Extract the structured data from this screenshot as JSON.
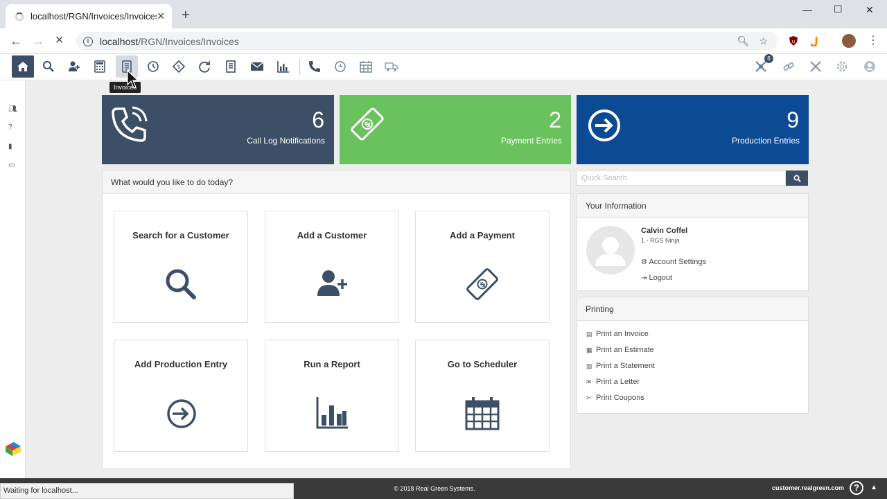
{
  "browser": {
    "tab_title": "localhost/RGN/Invoices/Invoices",
    "url_host": "localhost",
    "url_path": "/RGN/Invoices/Invoices"
  },
  "toolbar": {
    "tooltip": "Invoices",
    "notification_count": "6"
  },
  "tiles": [
    {
      "value": "6",
      "label": "Call Log Notifications",
      "color": "#3d4f66"
    },
    {
      "value": "2",
      "label": "Payment Entries",
      "color": "#6ac25f"
    },
    {
      "value": "9",
      "label": "Production Entries",
      "color": "#0d4a94"
    }
  ],
  "main": {
    "heading": "What would you like to do today?",
    "cards": [
      {
        "label": "Search for a Customer"
      },
      {
        "label": "Add a Customer"
      },
      {
        "label": "Add a Payment"
      },
      {
        "label": "Add Production Entry"
      },
      {
        "label": "Run a Report"
      },
      {
        "label": "Go to Scheduler"
      }
    ]
  },
  "search": {
    "placeholder": "Quick Search"
  },
  "user_info": {
    "heading": "Your Information",
    "name": "Calvin Coffel",
    "role": "1 - RGS Ninja",
    "account_settings": "Account Settings",
    "logout": "Logout"
  },
  "printing": {
    "heading": "Printing",
    "links": [
      "Print an Invoice",
      "Print an Estimate",
      "Print a Statement",
      "Print a Letter",
      "Print Coupons"
    ]
  },
  "footer": {
    "copyright": "© 2018 Real Green Systems.",
    "site": "customer.realgreen.com"
  },
  "status_bar": "Waiting for localhost...",
  "colors": {
    "navy": "#3d4f66",
    "green": "#6ac25f",
    "blue": "#0d4a94"
  }
}
